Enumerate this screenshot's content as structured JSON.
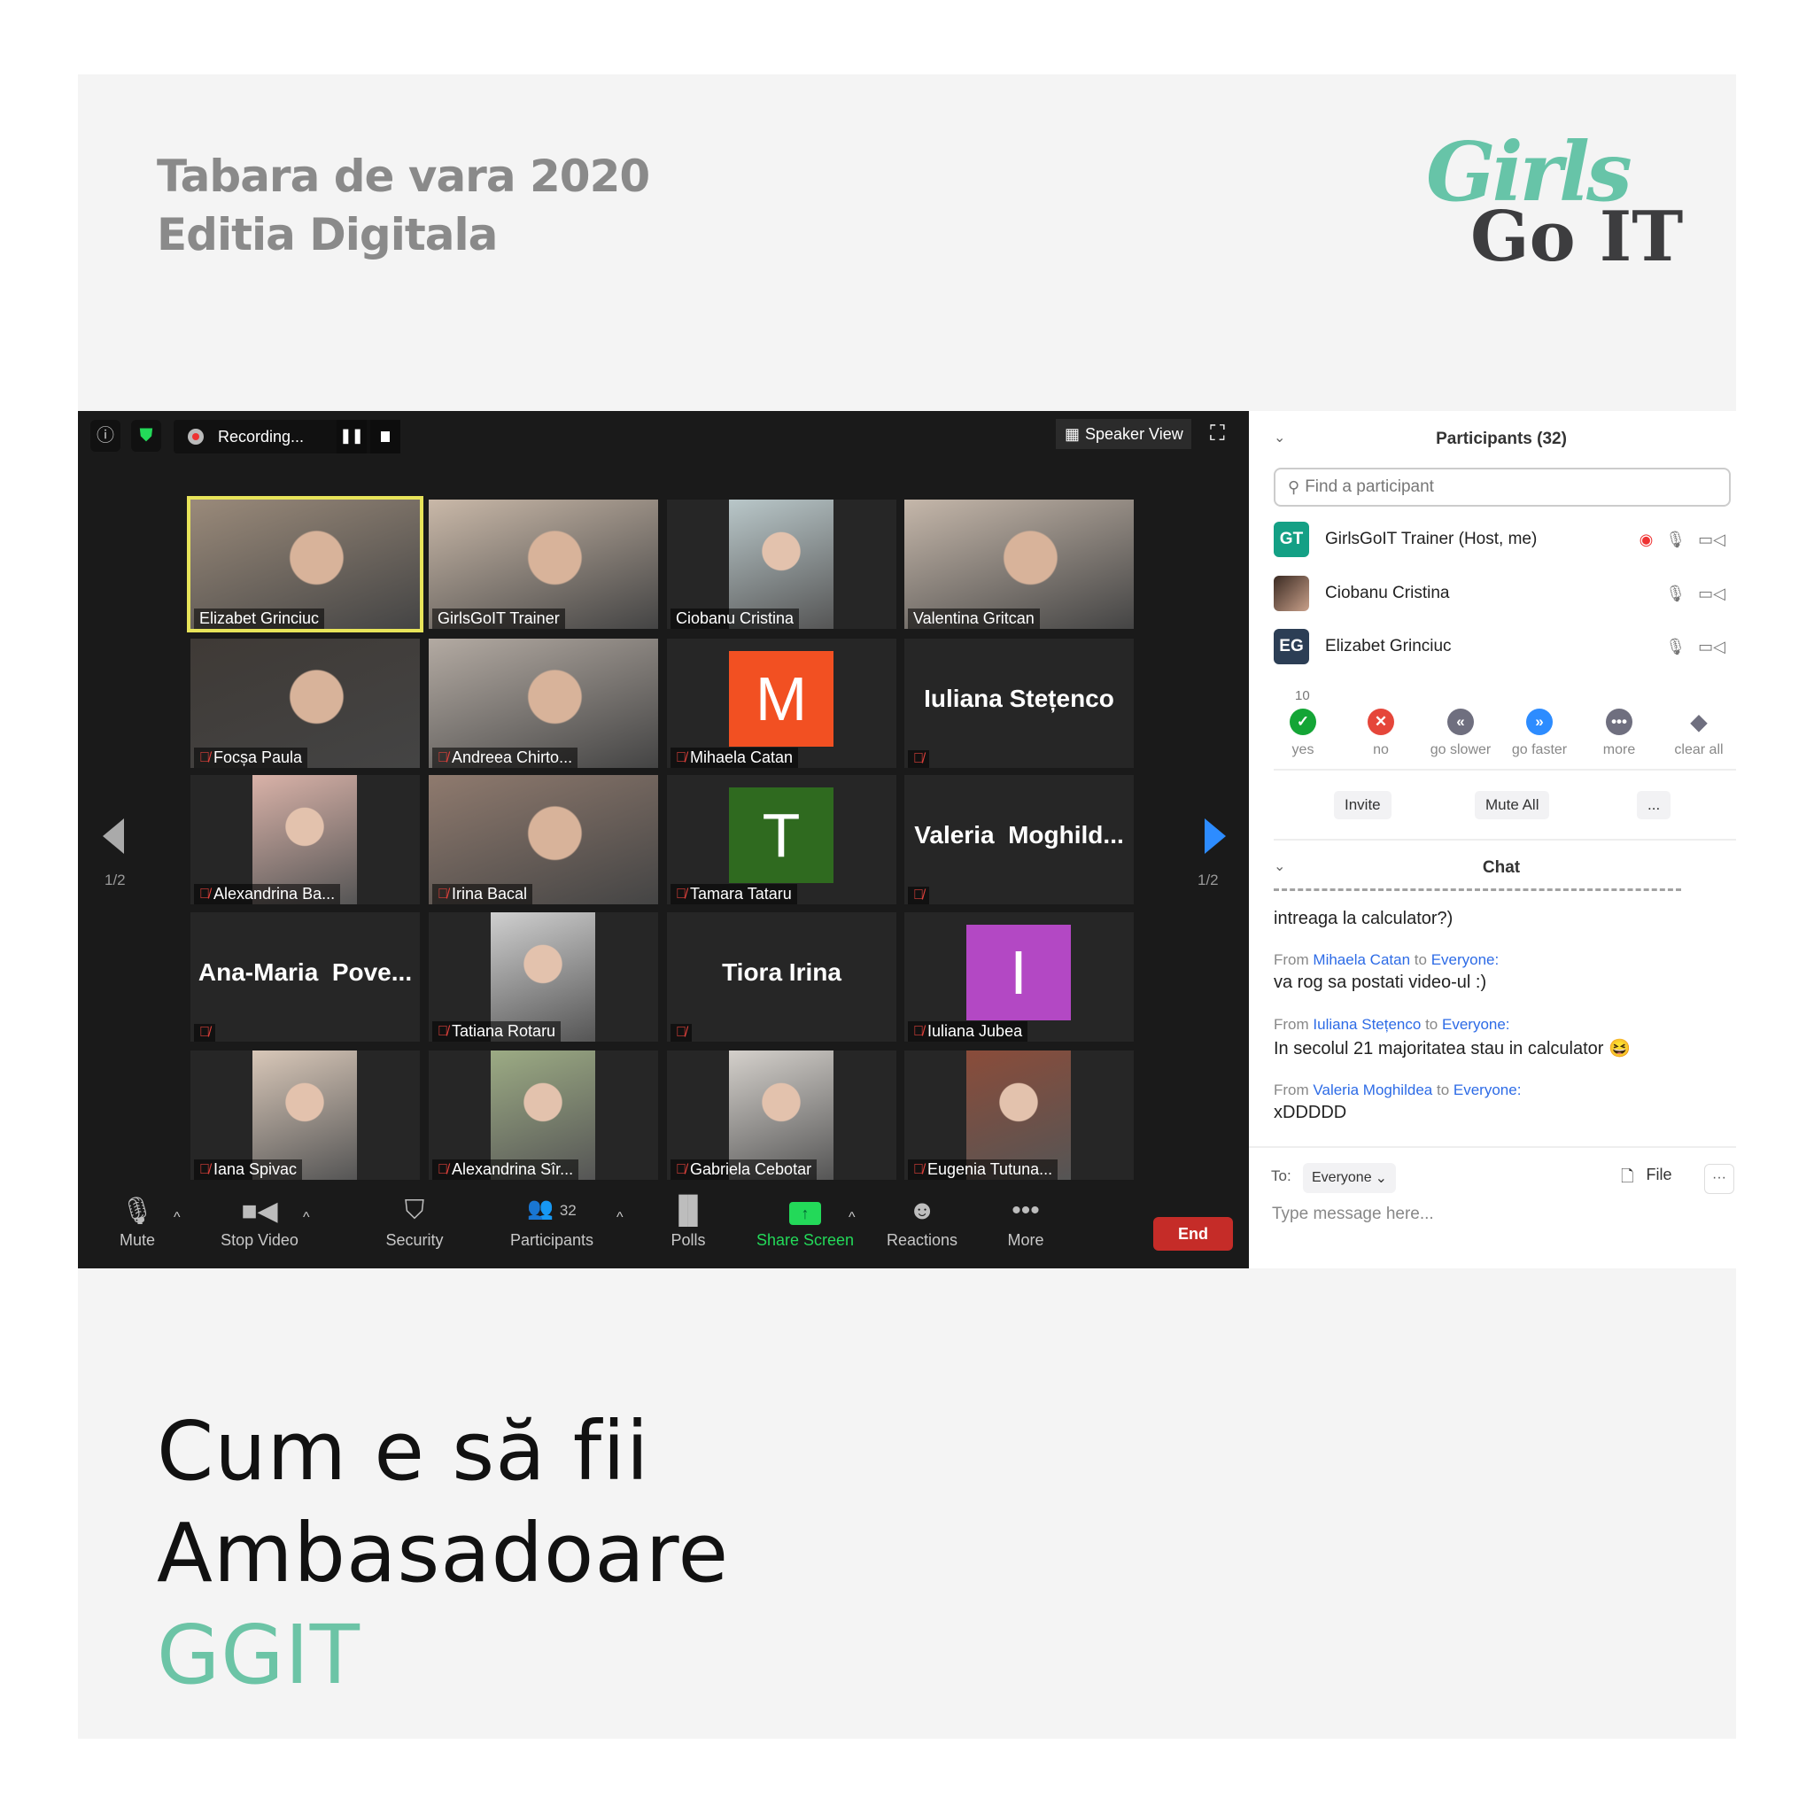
{
  "header": {
    "line1": "Tabara de vara 2020",
    "line2": "Editia Digitala"
  },
  "logo": {
    "top": "Girls",
    "bottom": "Go IT"
  },
  "headline": {
    "line1": "Cum e să fii",
    "line2": "Ambasadoare",
    "line3": "GGIT",
    "accent": "#6cc4a6"
  },
  "topbar": {
    "recording": "Recording...",
    "speaker_view": "Speaker View"
  },
  "nav": {
    "page_left": "1/2",
    "page_right": "1/2"
  },
  "tiles": [
    {
      "name": "Elizabet Grinciuc",
      "kind": "video",
      "muted": false,
      "speaker": true,
      "bg": "#9a8a7a"
    },
    {
      "name": "GirlsGoIT Trainer",
      "kind": "video",
      "muted": false,
      "bg": "#c9b8a8"
    },
    {
      "name": "Ciobanu Cristina",
      "kind": "portrait",
      "muted": false,
      "bg": "#b9c7c9"
    },
    {
      "name": "Valentina Gritcan",
      "kind": "video",
      "muted": false,
      "bg": "#c5b7aa"
    },
    {
      "name": "Focșa Paula",
      "kind": "video",
      "muted": true,
      "bg": "#3f3a36"
    },
    {
      "name": "Andreea Chirto...",
      "kind": "video",
      "muted": true,
      "bg": "#b3aaa2"
    },
    {
      "name": "Mihaela Catan",
      "kind": "avatar",
      "letter": "M",
      "color": "#f25022",
      "muted": true
    },
    {
      "name": "Iuliana Stețenco",
      "kind": "name",
      "muted": true
    },
    {
      "name": "Alexandrina Ba...",
      "kind": "portrait",
      "muted": true,
      "bg": "#d9b2a8"
    },
    {
      "name": "Irina Bacal",
      "kind": "video",
      "muted": true,
      "bg": "#8f7a6e"
    },
    {
      "name": "Tamara Tataru",
      "kind": "avatar",
      "letter": "T",
      "color": "#2f6a1f",
      "muted": true
    },
    {
      "name": "Valeria  Moghild...",
      "kind": "name",
      "muted": true
    },
    {
      "name": "Ana-Maria  Pove...",
      "kind": "name",
      "muted": true
    },
    {
      "name": "Tatiana Rotaru",
      "kind": "portrait",
      "muted": true,
      "bg": "#cfcfcf"
    },
    {
      "name": "Tiora Irina",
      "kind": "name",
      "muted": true
    },
    {
      "name": "Iuliana Jubea",
      "kind": "avatar",
      "letter": "I",
      "color": "#b348c4",
      "muted": true
    },
    {
      "name": "Iana Spivac",
      "kind": "portrait",
      "muted": true,
      "bg": "#d8c7b8"
    },
    {
      "name": "Alexandrina Sîr...",
      "kind": "portrait",
      "muted": true,
      "bg": "#9cab84"
    },
    {
      "name": "Gabriela Cebotar",
      "kind": "portrait",
      "muted": true,
      "bg": "#d4d0cb"
    },
    {
      "name": "Eugenia Tutuna...",
      "kind": "portrait",
      "muted": true,
      "bg": "#8a4c3a"
    }
  ],
  "toolbar": {
    "mute": "Mute",
    "stop_video": "Stop Video",
    "security": "Security",
    "participants": "Participants",
    "participants_count": "32",
    "polls": "Polls",
    "share_screen": "Share Screen",
    "reactions": "Reactions",
    "more": "More",
    "end": "End"
  },
  "participants": {
    "title": "Participants (32)",
    "search_placeholder": "Find a participant",
    "list": [
      {
        "initials": "GT",
        "name": "GirlsGoIT Trainer (Host, me)",
        "color": "#14a085"
      },
      {
        "initials": "",
        "name": "Ciobanu Cristina",
        "color": "#6a4a3a"
      },
      {
        "initials": "EG",
        "name": "Elizabet Grinciuc",
        "color": "#2c3e55"
      }
    ],
    "reactions": [
      {
        "label": "yes",
        "count": "10",
        "color": "#14a536",
        "glyph": "✓"
      },
      {
        "label": "no",
        "color": "#e5463a",
        "glyph": "✕"
      },
      {
        "label": "go slower",
        "color": "#6f6f7f",
        "glyph": "«"
      },
      {
        "label": "go faster",
        "color": "#2d8cff",
        "glyph": "»"
      },
      {
        "label": "more",
        "color": "#6f6f7f",
        "glyph": "•••"
      },
      {
        "label": "clear all",
        "color": "#fff",
        "glyph": "◆"
      }
    ],
    "invite": "Invite",
    "mute_all": "Mute All",
    "more": "..."
  },
  "chat": {
    "title": "Chat",
    "clipped_line": "intreaga la calculator?)",
    "messages": [
      {
        "from_label": "From",
        "sender": "Mihaela Catan",
        "to_label": "to",
        "to": "Everyone:",
        "text": "va rog sa postati video-ul :)"
      },
      {
        "from_label": "From",
        "sender": "Iuliana Stețenco",
        "to_label": "to",
        "to": "Everyone:",
        "text": "In secolul 21 majoritatea stau in calculator 😆"
      },
      {
        "from_label": "From",
        "sender": "Valeria Moghildea",
        "to_label": "to",
        "to": "Everyone:",
        "text": "xDDDDD"
      }
    ],
    "to_label": "To:",
    "to_value": "Everyone",
    "file": "File",
    "more": "···",
    "placeholder": "Type message here..."
  }
}
